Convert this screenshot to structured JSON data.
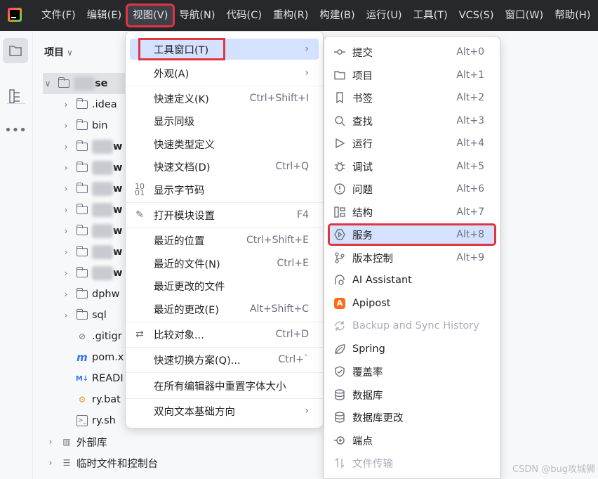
{
  "menubar": {
    "items": [
      "文件(F)",
      "编辑(E)",
      "视图(V)",
      "导航(N)",
      "代码(C)",
      "重构(R)",
      "构建(B)",
      "运行(U)",
      "工具(T)",
      "VCS(S)",
      "窗口(W)",
      "帮助(H)"
    ],
    "active": "视图(V)"
  },
  "project_panel": {
    "title": "项目",
    "tree": [
      {
        "label": "se"
      },
      {
        "label": ".idea"
      },
      {
        "label": "bin"
      },
      {
        "label": "w"
      },
      {
        "label": "w"
      },
      {
        "label": "w"
      },
      {
        "label": "w"
      },
      {
        "label": "w"
      },
      {
        "label": "w"
      },
      {
        "label": "w"
      },
      {
        "label": "dphw"
      },
      {
        "label": "sql"
      },
      {
        "label": ".gitigr"
      },
      {
        "label": "pom.x"
      },
      {
        "label": "READI"
      },
      {
        "label": "ry.bat"
      },
      {
        "label": "ry.sh"
      },
      {
        "label": "外部库"
      },
      {
        "label": "临时文件和控制台"
      }
    ]
  },
  "view_menu": {
    "items": [
      {
        "label": "工具窗口(T)",
        "shortcut": "",
        "submenu": true
      },
      {
        "label": "外观(A)",
        "shortcut": "",
        "submenu": true
      },
      {
        "label": "快速定义(K)",
        "shortcut": "Ctrl+Shift+I"
      },
      {
        "label": "显示同级",
        "shortcut": ""
      },
      {
        "label": "快速类型定义",
        "shortcut": ""
      },
      {
        "label": "快速文档(D)",
        "shortcut": "Ctrl+Q"
      },
      {
        "label": "显示字节码",
        "shortcut": ""
      },
      {
        "label": "打开模块设置",
        "shortcut": "F4"
      },
      {
        "label": "最近的位置",
        "shortcut": "Ctrl+Shift+E"
      },
      {
        "label": "最近的文件(N)",
        "shortcut": "Ctrl+E"
      },
      {
        "label": "最近更改的文件",
        "shortcut": ""
      },
      {
        "label": "最近的更改(E)",
        "shortcut": "Alt+Shift+C"
      },
      {
        "label": "比较对象...",
        "shortcut": "Ctrl+D"
      },
      {
        "label": "快速切换方案(Q)...",
        "shortcut": "Ctrl+`"
      },
      {
        "label": "在所有编辑器中重置字体大小",
        "shortcut": ""
      },
      {
        "label": "双向文本基础方向",
        "shortcut": "",
        "submenu": true
      }
    ]
  },
  "tool_windows": {
    "items": [
      {
        "label": "提交",
        "shortcut": "Alt+0",
        "icon": "commit-icon"
      },
      {
        "label": "项目",
        "shortcut": "Alt+1",
        "icon": "folder-icon"
      },
      {
        "label": "书签",
        "shortcut": "Alt+2",
        "icon": "bookmark-icon"
      },
      {
        "label": "查找",
        "shortcut": "Alt+3",
        "icon": "search-icon"
      },
      {
        "label": "运行",
        "shortcut": "Alt+4",
        "icon": "run-icon"
      },
      {
        "label": "调试",
        "shortcut": "Alt+5",
        "icon": "debug-icon"
      },
      {
        "label": "问题",
        "shortcut": "Alt+6",
        "icon": "problems-icon"
      },
      {
        "label": "结构",
        "shortcut": "Alt+7",
        "icon": "structure-icon"
      },
      {
        "label": "服务",
        "shortcut": "Alt+8",
        "icon": "services-icon"
      },
      {
        "label": "版本控制",
        "shortcut": "Alt+9",
        "icon": "vcs-icon"
      },
      {
        "label": "AI Assistant",
        "shortcut": "",
        "icon": "ai-assistant-icon"
      },
      {
        "label": "Apipost",
        "shortcut": "",
        "icon": "apipost-icon"
      },
      {
        "label": "Backup and Sync History",
        "shortcut": "",
        "icon": "sync-icon",
        "disabled": true
      },
      {
        "label": "Spring",
        "shortcut": "",
        "icon": "spring-icon"
      },
      {
        "label": "覆盖率",
        "shortcut": "",
        "icon": "coverage-icon"
      },
      {
        "label": "数据库",
        "shortcut": "",
        "icon": "database-icon"
      },
      {
        "label": "数据库更改",
        "shortcut": "",
        "icon": "database-changes-icon"
      },
      {
        "label": "端点",
        "shortcut": "",
        "icon": "endpoints-icon"
      },
      {
        "label": "文件传输",
        "shortcut": "",
        "icon": "file-transfer-icon",
        "disabled": true
      }
    ]
  },
  "watermark": "CSDN @bug攻城狮",
  "colors": {
    "titlebar": "#27282c",
    "highlight": "#d4e2ff",
    "annotation_red": "#e0353f",
    "accent": "#3574f0"
  }
}
